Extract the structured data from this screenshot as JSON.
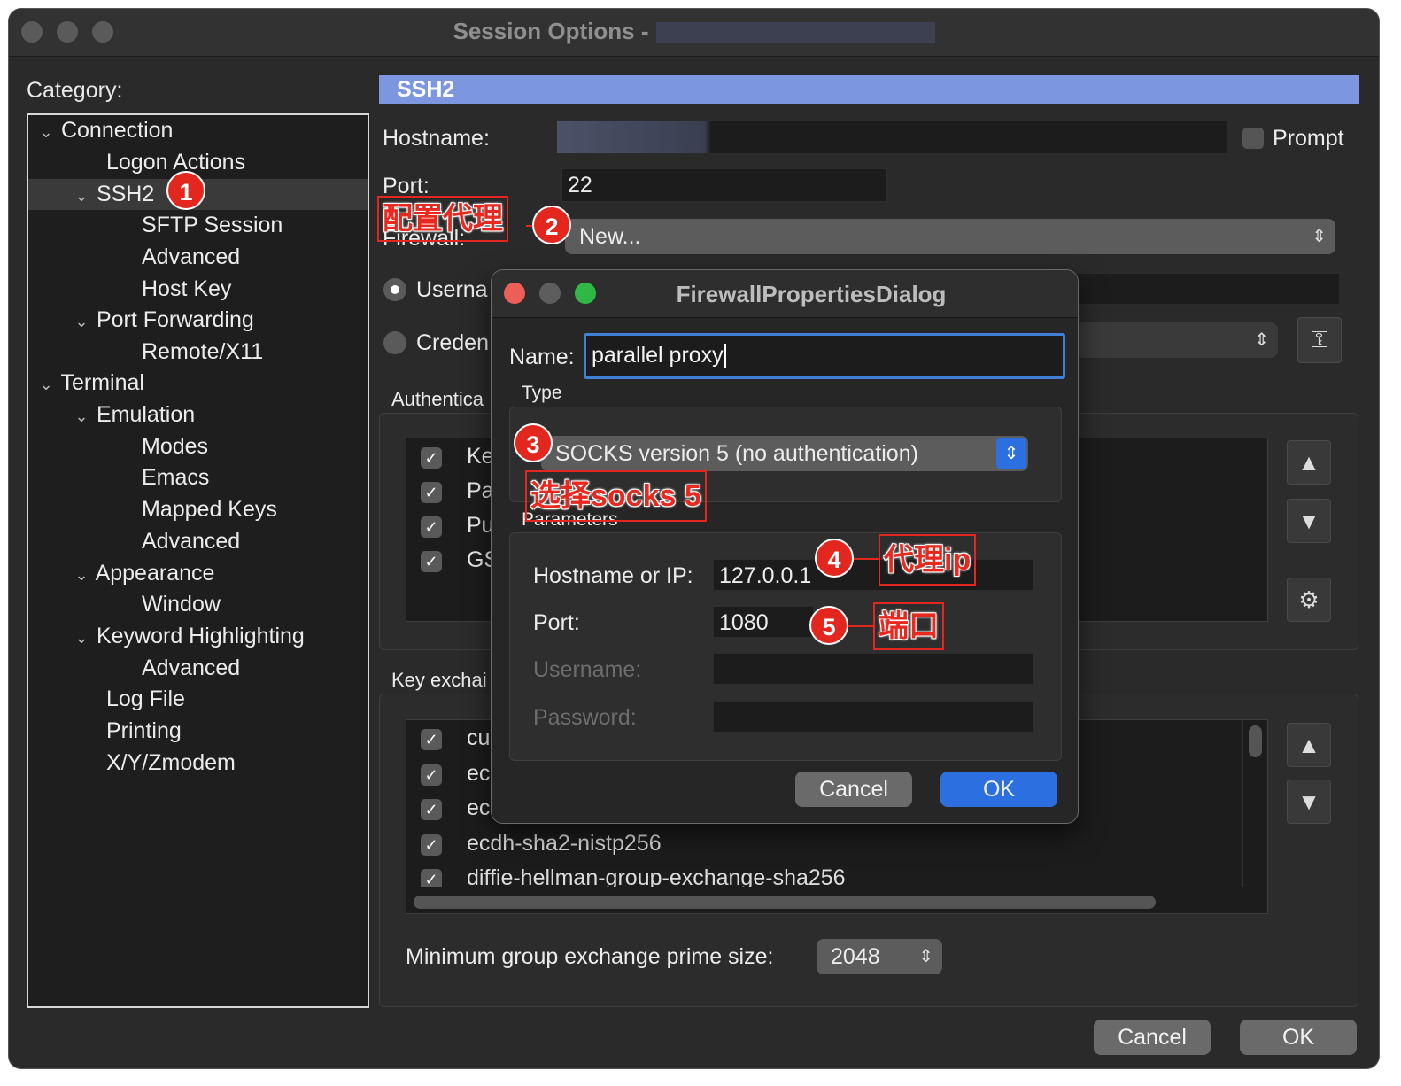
{
  "window": {
    "title": "Session Options -",
    "traffic_lights": [
      "close",
      "minimize",
      "zoom"
    ]
  },
  "category": {
    "label": "Category:",
    "tree": [
      {
        "label": "Connection",
        "expanded": true
      },
      {
        "label": "Logon Actions"
      },
      {
        "label": "SSH2",
        "expanded": true,
        "selected": true
      },
      {
        "label": "SFTP Session"
      },
      {
        "label": "Advanced"
      },
      {
        "label": "Host Key"
      },
      {
        "label": "Port Forwarding",
        "expanded": true
      },
      {
        "label": "Remote/X11"
      },
      {
        "label": "Terminal",
        "expanded": true
      },
      {
        "label": "Emulation",
        "expanded": true
      },
      {
        "label": "Modes"
      },
      {
        "label": "Emacs"
      },
      {
        "label": "Mapped Keys"
      },
      {
        "label": "Advanced"
      },
      {
        "label": "Appearance",
        "expanded": true
      },
      {
        "label": "Window"
      },
      {
        "label": "Keyword Highlighting",
        "expanded": true
      },
      {
        "label": "Advanced"
      },
      {
        "label": "Log File"
      },
      {
        "label": "Printing"
      },
      {
        "label": "X/Y/Zmodem"
      }
    ]
  },
  "ssh2": {
    "header": "SSH2",
    "hostname_label": "Hostname:",
    "hostname_value": "",
    "prompt_label": "Prompt",
    "port_label": "Port:",
    "port_value": "22",
    "firewall_label": "Firewall:",
    "firewall_value": "New...",
    "username_label": "Userna",
    "credentials_label": "Creden",
    "auth_label": "Authentica",
    "auth_items": [
      "Ke",
      "Pa",
      "Pu",
      "GS"
    ],
    "kex_label": "Key exchai",
    "kex_items": [
      "cu",
      "ec",
      "ec",
      "ecdh-sha2-nistp256",
      "diffie-hellman-group-exchange-sha256"
    ],
    "min_group_label": "Minimum group exchange prime size:",
    "min_group_value": "2048",
    "cancel": "Cancel",
    "ok": "OK"
  },
  "dialog": {
    "title": "FirewallPropertiesDialog",
    "name_label": "Name:",
    "name_value": "parallel proxy",
    "type_label": "Type",
    "type_value": "SOCKS version 5 (no authentication)",
    "params_label": "Parameters",
    "host_label": "Hostname or IP:",
    "host_value": "127.0.0.1",
    "port_label": "Port:",
    "port_value": "1080",
    "username_label": "Username:",
    "password_label": "Password:",
    "cancel": "Cancel",
    "ok": "OK"
  },
  "annotations": {
    "b1": "1",
    "b2": "2",
    "b3": "3",
    "b4": "4",
    "b5": "5",
    "a2": "配置代理",
    "a3": "选择socks 5",
    "a4": "代理ip",
    "a5": "端口"
  },
  "colors": {
    "header_bar": "#7d96e0",
    "badge": "#e3271e",
    "primary_button": "#2c6fe0",
    "close": "#ec5f56",
    "minimize": "#5d5d5d",
    "zoom": "#30b847"
  }
}
